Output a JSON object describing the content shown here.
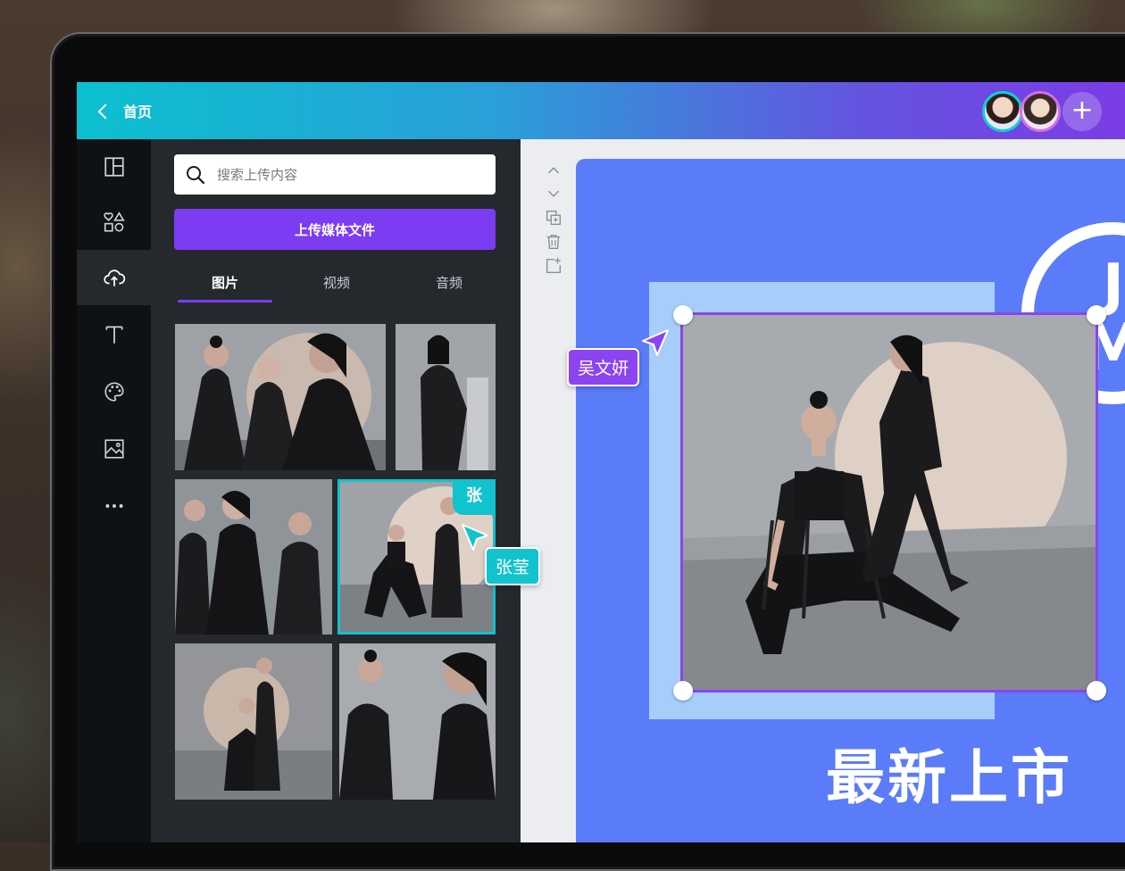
{
  "header": {
    "back_label": "首页",
    "add_label": "+"
  },
  "rail": {
    "items": [
      "layout-icon",
      "elements-icon",
      "upload-cloud-icon",
      "text-icon",
      "palette-icon",
      "image-icon",
      "more-icon"
    ]
  },
  "panel": {
    "search_placeholder": "搜索上传内容",
    "upload_button": "上传媒体文件",
    "tabs": [
      "图片",
      "视频",
      "音频"
    ],
    "selected_owner_tag": "张"
  },
  "canvas": {
    "headline": "最新上市",
    "logo_letters": [
      "J",
      "M"
    ]
  },
  "collaborators": {
    "purple_name": "吴文妍",
    "teal_name": "张莹"
  },
  "colors": {
    "accent_purple": "#7c3cf2",
    "accent_teal": "#11c3cd",
    "design_bg": "#5b7cf8"
  }
}
